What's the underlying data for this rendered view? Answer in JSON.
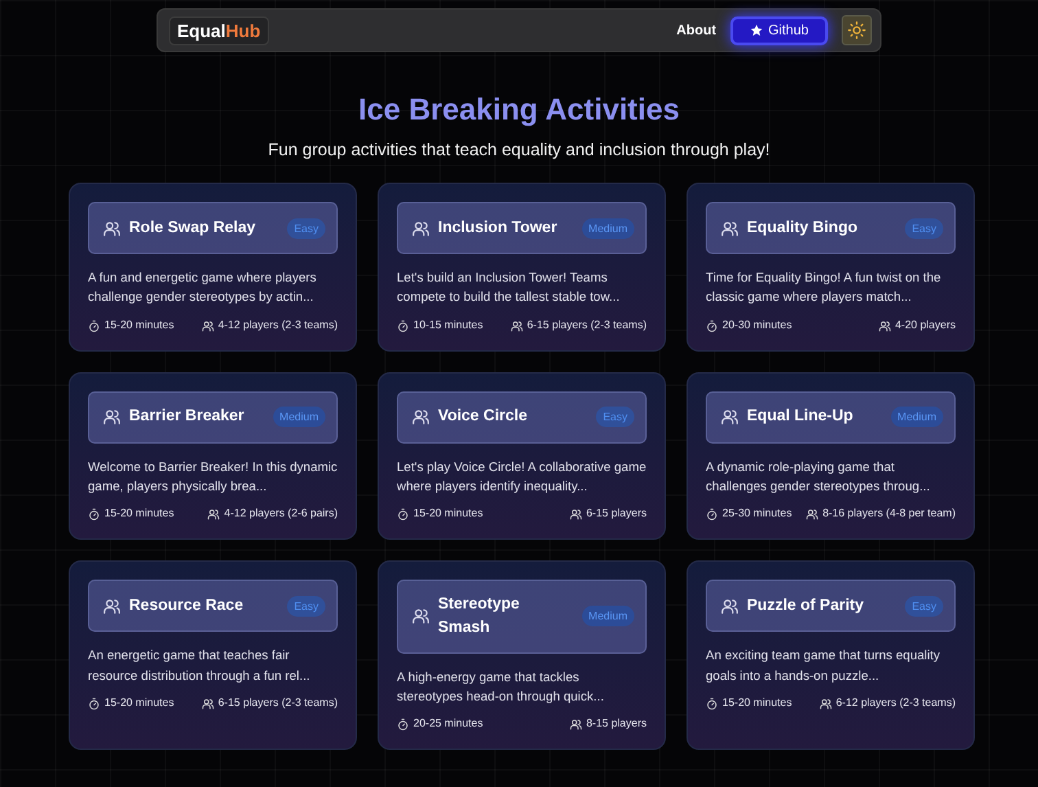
{
  "navbar": {
    "logo_left": "Equal",
    "logo_right": "Hub",
    "links": [
      {
        "label": "About"
      }
    ],
    "github_button": "Github"
  },
  "header": {
    "title": "Ice Breaking Activities",
    "subtitle": "Fun group activities that teach equality and inclusion through play!"
  },
  "activities": [
    {
      "title": "Role Swap Relay",
      "difficulty": "Easy",
      "description": "A fun and energetic game where players challenge gender stereotypes by actin...",
      "duration": "15-20 minutes",
      "players": "4-12 players (2-3 teams)"
    },
    {
      "title": "Inclusion Tower",
      "difficulty": "Medium",
      "description": "Let's build an Inclusion Tower! Teams compete to build the tallest stable tow...",
      "duration": "10-15 minutes",
      "players": "6-15 players (2-3 teams)"
    },
    {
      "title": "Equality Bingo",
      "difficulty": "Easy",
      "description": "Time for Equality Bingo! A fun twist on the classic game where players match...",
      "duration": "20-30 minutes",
      "players": "4-20 players"
    },
    {
      "title": "Barrier Breaker",
      "difficulty": "Medium",
      "description": "Welcome to Barrier Breaker! In this dynamic game, players physically brea...",
      "duration": "15-20 minutes",
      "players": "4-12 players (2-6 pairs)"
    },
    {
      "title": "Voice Circle",
      "difficulty": "Easy",
      "description": "Let's play Voice Circle! A collaborative game where players identify inequality...",
      "duration": "15-20 minutes",
      "players": "6-15 players"
    },
    {
      "title": "Equal Line-Up",
      "difficulty": "Medium",
      "description": "A dynamic role-playing game that challenges gender stereotypes throug...",
      "duration": "25-30 minutes",
      "players": "8-16 players (4-8 per team)"
    },
    {
      "title": "Resource Race",
      "difficulty": "Easy",
      "description": "An energetic game that teaches fair resource distribution through a fun rel...",
      "duration": "15-20 minutes",
      "players": "6-15 players (2-3 teams)"
    },
    {
      "title": "Stereotype Smash",
      "difficulty": "Medium",
      "description": "A high-energy game that tackles stereotypes head-on through quick...",
      "duration": "20-25 minutes",
      "players": "8-15 players"
    },
    {
      "title": "Puzzle of Parity",
      "difficulty": "Easy",
      "description": "An exciting team game that turns equality goals into a hands-on puzzle...",
      "duration": "15-20 minutes",
      "players": "6-12 players (2-3 teams)"
    }
  ]
}
